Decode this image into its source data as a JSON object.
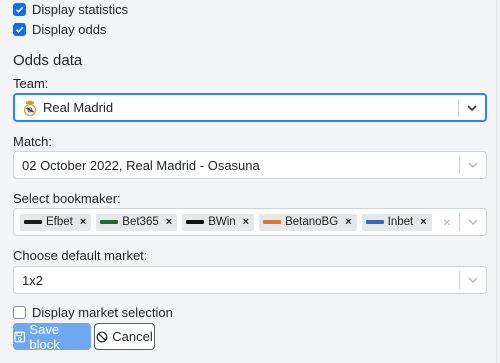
{
  "checks": {
    "display_statistics": {
      "label": "Display statistics",
      "checked": true
    },
    "display_odds": {
      "label": "Display odds",
      "checked": true
    },
    "display_market_selection": {
      "label": "Display market selection",
      "checked": false
    }
  },
  "section_title": "Odds data",
  "team": {
    "label": "Team:",
    "value": "Real Madrid",
    "crest_icon": "real-madrid-crest-icon"
  },
  "match": {
    "label": "Match:",
    "value": "02 October 2022, Real Madrid - Osasuna"
  },
  "bookmaker": {
    "label": "Select bookmaker:",
    "tags": [
      {
        "name": "Efbet",
        "logo_color": "#1a1a1a"
      },
      {
        "name": "Bet365",
        "logo_color": "#1e6b3a"
      },
      {
        "name": "BWin",
        "logo_color": "#111111"
      },
      {
        "name": "BetanoBG",
        "logo_color": "#e8742a"
      },
      {
        "name": "Inbet",
        "logo_color": "#2f6fb5"
      }
    ],
    "remove_symbol": "×",
    "clear_symbol": "×"
  },
  "market": {
    "label": "Choose default market:",
    "value": "1x2"
  },
  "buttons": {
    "save": "Save block",
    "cancel": "Cancel"
  },
  "colors": {
    "accent": "#0d6efd",
    "focus_border": "#2684ff",
    "save_button": "#6ea8f0"
  }
}
